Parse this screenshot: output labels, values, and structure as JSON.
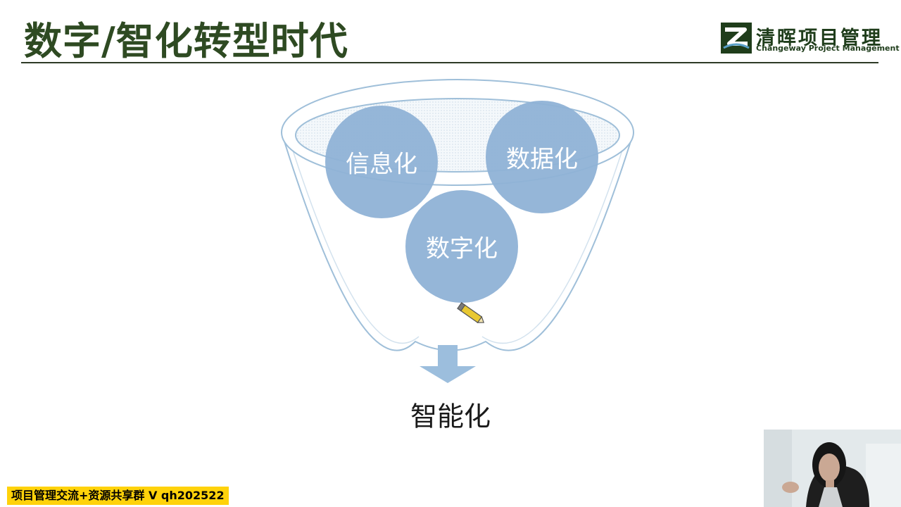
{
  "slide": {
    "title": "数字/智化转型时代",
    "logo": {
      "name_cn": "清晖项目管理",
      "name_en": "Changeway Project Management"
    },
    "diagram": {
      "circles": [
        {
          "label": "信息化"
        },
        {
          "label": "数据化"
        },
        {
          "label": "数字化"
        }
      ],
      "result": "智能化"
    },
    "banner": "项目管理交流+资源共享群 V qh202522"
  },
  "colors": {
    "title": "#2e4a22",
    "circle": "#8fb2d6",
    "funnel_stroke": "#9fbfd9",
    "banner": "#ffd20a"
  },
  "icons": [
    "logo-mark-icon",
    "down-arrow-icon",
    "pen-icon"
  ]
}
